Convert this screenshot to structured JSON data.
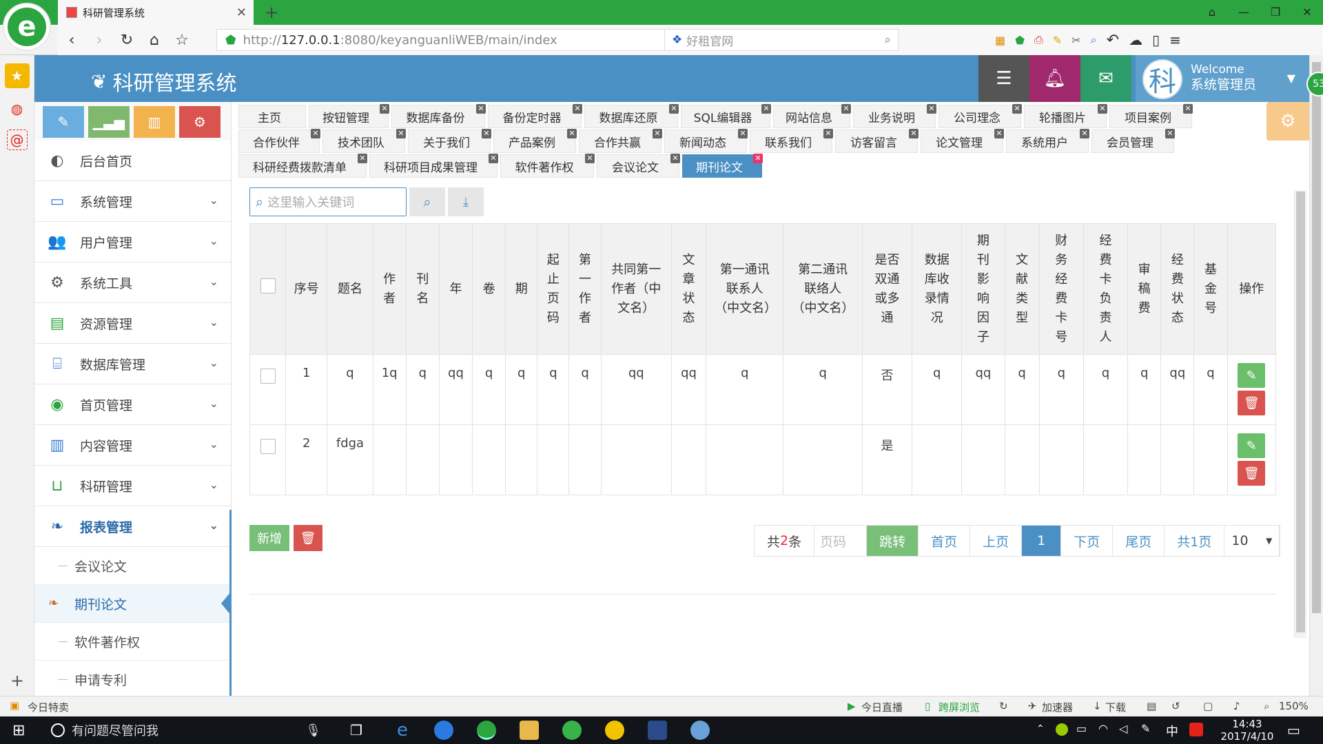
{
  "browser": {
    "tab_title": "科研管理系统",
    "url_protocol": "http://",
    "url_host": "127.0.0.1",
    "url_rest": ":8080/keyanguanliWEB/main/index",
    "search_engine_label": "好租官网",
    "zoom": "150%",
    "status_left": "今日特卖",
    "status_items": [
      "今日直播",
      "跨屏浏览",
      "加速器",
      "下载"
    ]
  },
  "app": {
    "title": "科研管理系统",
    "welcome": "Welcome",
    "username": "系统管理员",
    "avatar_char": "科",
    "notif_count": "53"
  },
  "menu": {
    "items": [
      {
        "label": "后台首页",
        "icon": "dashboard-icon",
        "glyph": "◐"
      },
      {
        "label": "系统管理",
        "icon": "monitor-icon",
        "glyph": "▭"
      },
      {
        "label": "用户管理",
        "icon": "users-icon",
        "glyph": "👥"
      },
      {
        "label": "系统工具",
        "icon": "gear-icon",
        "glyph": "⚙"
      },
      {
        "label": "资源管理",
        "icon": "card-icon",
        "glyph": "▤"
      },
      {
        "label": "数据库管理",
        "icon": "drive-icon",
        "glyph": "⌸"
      },
      {
        "label": "首页管理",
        "icon": "globe-icon",
        "glyph": "◉"
      },
      {
        "label": "内容管理",
        "icon": "book-icon",
        "glyph": "▥"
      },
      {
        "label": "科研管理",
        "icon": "laptop-icon",
        "glyph": "⊔"
      },
      {
        "label": "报表管理",
        "icon": "leaf-icon",
        "glyph": "❧"
      }
    ],
    "subitems": [
      "会议论文",
      "期刊论文",
      "软件著作权",
      "申请专利"
    ]
  },
  "tabs": {
    "row1": [
      "主页",
      "按钮管理",
      "数据库备份",
      "备份定时器",
      "数据库还原",
      "SQL编辑器",
      "网站信息",
      "业务说明",
      "公司理念",
      "轮播图片",
      "项目案例"
    ],
    "row2": [
      "合作伙伴",
      "技术团队",
      "关于我们",
      "产品案例",
      "合作共赢",
      "新闻动态",
      "联系我们",
      "访客留言",
      "论文管理",
      "系统用户",
      "会员管理"
    ],
    "row3": [
      "科研经费拨款清单",
      "科研项目成果管理",
      "软件著作权",
      "会议论文",
      "期刊论文"
    ]
  },
  "search": {
    "placeholder": "这里输入关键词"
  },
  "table": {
    "headers": [
      "序号",
      "题名",
      "作者",
      "刊名",
      "年",
      "卷",
      "期",
      "起止页码",
      "第一作者",
      "共同第一作者（中文名）",
      "文章状态",
      "第一通讯联系人（中文名）",
      "第二通讯联络人（中文名）",
      "是否双通或多通",
      "数据库收录情况",
      "期刊影响因子",
      "文献类型",
      "财务经费卡号",
      "经费卡负责人",
      "审稿费",
      "经费状态",
      "基金号",
      "操作"
    ],
    "rows": [
      [
        "1",
        "q",
        "1q",
        "q",
        "qq",
        "q",
        "q",
        "q",
        "q",
        "qq",
        "qq",
        "q",
        "q",
        "否",
        "q",
        "qq",
        "q",
        "q",
        "q",
        "q",
        "qq",
        "q"
      ],
      [
        "2",
        "fdga",
        "",
        "",
        "",
        "",
        "",
        "",
        "",
        "",
        "",
        "",
        "",
        "是",
        "",
        "",
        "",
        "",
        "",
        "",
        "",
        ""
      ]
    ]
  },
  "actions": {
    "add_label": "新增"
  },
  "pager": {
    "total_prefix": "共",
    "total_count": "2",
    "total_suffix": "条",
    "page_placeholder": "页码",
    "go": "跳转",
    "first": "首页",
    "prev": "上页",
    "current": "1",
    "next": "下页",
    "last": "尾页",
    "pages": "共1页",
    "page_size": "10"
  },
  "taskbar": {
    "search_placeholder": "有问题尽管问我",
    "time": "14:43",
    "date": "2017/4/10",
    "ime": "中"
  },
  "colors": {
    "header_blue": "#4a90c4",
    "browser_green": "#2aa53f",
    "edit_green": "#6bbf6b",
    "delete_red": "#d9534f"
  }
}
